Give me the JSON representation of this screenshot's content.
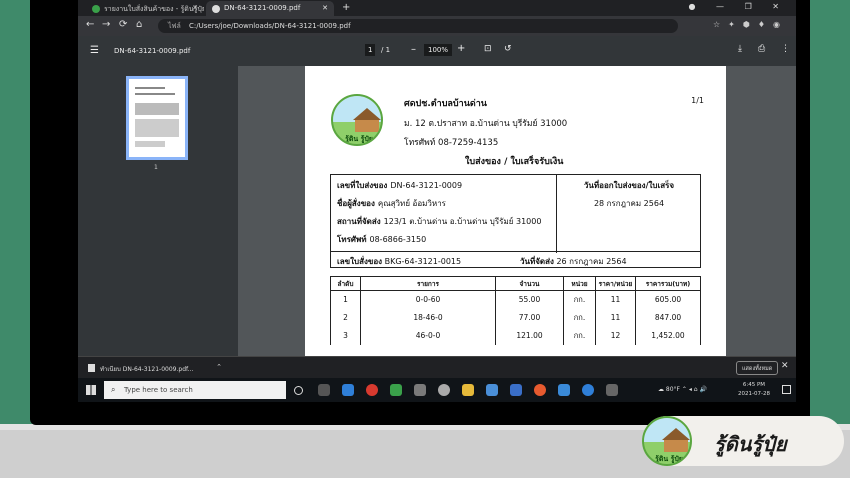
{
  "browser": {
    "tabs": [
      {
        "label": "รายงานใบสั่งสินค้าของ - รู้ดินรู้ปุ๋ย"
      },
      {
        "label": "DN-64-3121-0009.pdf"
      }
    ],
    "nav": {
      "back": "←",
      "forward": "→",
      "reload": "⟳",
      "home": "⌂"
    },
    "address": {
      "security": "ไฟล์",
      "url": "C:/Users/joe/Downloads/DN-64-3121-0009.pdf"
    }
  },
  "pdf_toolbar": {
    "filename": "DN-64-3121-0009.pdf",
    "page_current": "1",
    "page_total": "/ 1",
    "zoom": "100%"
  },
  "sidebar": {
    "thumb_label": "1"
  },
  "document": {
    "logo_text": "รู้ดิน รู้ปุ๋ย",
    "org_name": "ศดปช.ตำบลบ้านด่าน",
    "address": "ม. 12 ต.ปราสาท อ.บ้านด่าน บุรีรัมย์ 31000",
    "phone": "โทรศัพท์ 08-7259-4135",
    "page_no": "1/1",
    "title": "ใบส่งของ / ใบเสร็จรับเงิน",
    "info": {
      "delivery_no_label": "เลขที่ใบส่งของ",
      "delivery_no": "DN-64-3121-0009",
      "buyer_label": "ชื่อผู้สั่งของ",
      "buyer": "คุณสุวิทย์ อ้อมวิหาร",
      "place_label": "สถานที่จัดส่ง",
      "place": "123/1 ต.บ้านด่าน อ.บ้านด่าน บุรีรัมย์ 31000",
      "tel_label": "โทรศัพท์",
      "tel": "08-6866-3150",
      "date_label": "วันที่ออกใบส่งของ/ใบเสร็จ",
      "date": "28 กรกฎาคม 2564",
      "order_no_label": "เลขใบสั่งของ",
      "order_no": "BKG-64-3121-0015",
      "ship_date_label": "วันที่จัดส่ง",
      "ship_date": "26 กรกฎาคม 2564"
    },
    "table": {
      "headers": [
        "ลำดับ",
        "รายการ",
        "จำนวน",
        "หน่วย",
        "ราคา/หน่วย",
        "ราคารวม(บาท)"
      ],
      "rows": [
        [
          "1",
          "0-0-60",
          "55.00",
          "กก.",
          "11",
          "605.00"
        ],
        [
          "2",
          "18-46-0",
          "77.00",
          "กก.",
          "11",
          "847.00"
        ],
        [
          "3",
          "46-0-0",
          "121.00",
          "กก.",
          "12",
          "1,452.00"
        ]
      ]
    }
  },
  "download_bar": {
    "item": "ทำเนียบ DN-64-3121-0009.pdf...",
    "show_all": "แสดงทั้งหมด"
  },
  "taskbar": {
    "search_placeholder": "Type here to search",
    "weather": "80°F",
    "time": "6:45 PM",
    "date": "2021-07-28"
  },
  "brand": {
    "text": "รู้ดินรู้ปุ๋ย",
    "logo_text": "รู้ดิน รู้ปุ๋ย"
  }
}
